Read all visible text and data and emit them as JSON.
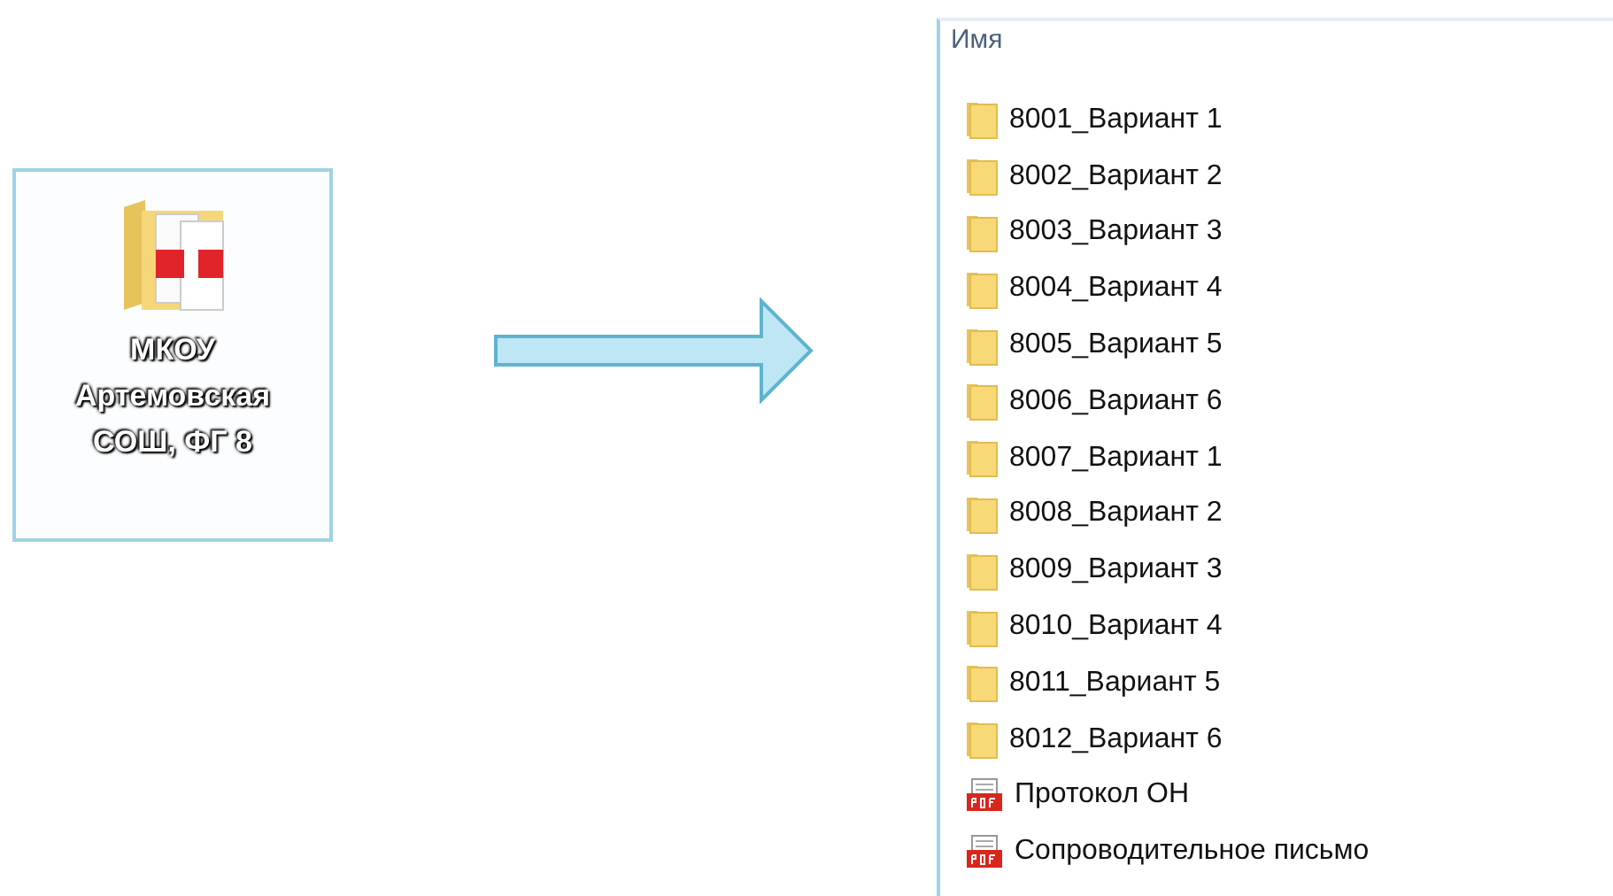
{
  "desktop_icon": {
    "label": "МКОУ Артемовская СОШ, ФГ 8",
    "selected": true
  },
  "file_list": {
    "column_header": "Имя",
    "items": [
      {
        "name": "8001_Вариант 1",
        "kind": "folder"
      },
      {
        "name": "8002_Вариант 2",
        "kind": "folder"
      },
      {
        "name": "8003_Вариант 3",
        "kind": "folder"
      },
      {
        "name": "8004_Вариант 4",
        "kind": "folder"
      },
      {
        "name": "8005_Вариант 5",
        "kind": "folder"
      },
      {
        "name": "8006_Вариант 6",
        "kind": "folder"
      },
      {
        "name": "8007_Вариант 1",
        "kind": "folder"
      },
      {
        "name": "8008_Вариант 2",
        "kind": "folder"
      },
      {
        "name": "8009_Вариант 3",
        "kind": "folder"
      },
      {
        "name": "8010_Вариант 4",
        "kind": "folder"
      },
      {
        "name": "8011_Вариант 5",
        "kind": "folder"
      },
      {
        "name": "8012_Вариант 6",
        "kind": "folder"
      },
      {
        "name": "Протокол ОН",
        "kind": "pdf"
      },
      {
        "name": "Сопроводительное письмо",
        "kind": "pdf"
      }
    ]
  }
}
